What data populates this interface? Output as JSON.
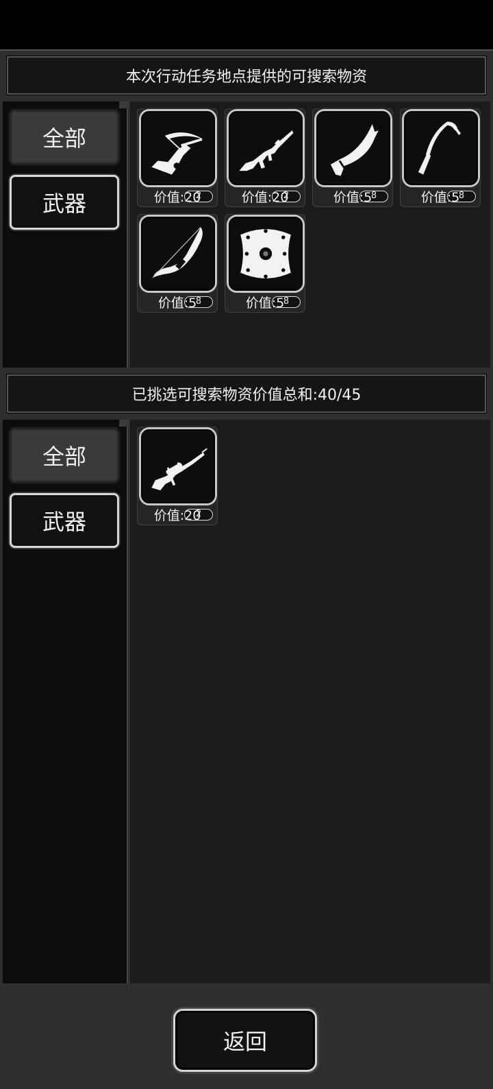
{
  "available": {
    "title": "本次行动任务地点提供的可搜索物资",
    "tabs": {
      "all": "全部",
      "weapon": "武器"
    },
    "items": [
      {
        "icon": "crossbow-icon",
        "count": "2",
        "value": "价值:20"
      },
      {
        "icon": "assault-rifle-icon",
        "count": "2",
        "value": "价值:20"
      },
      {
        "icon": "kukri-knife-icon",
        "count": "8",
        "value": "价值:5"
      },
      {
        "icon": "sickle-icon",
        "count": "8",
        "value": "价值:5"
      },
      {
        "icon": "recurve-bow-icon",
        "count": "8",
        "value": "价值:5"
      },
      {
        "icon": "round-shield-icon",
        "count": "8",
        "value": "价值:5"
      }
    ]
  },
  "selected": {
    "title": "已挑选可搜索物资价值总和:40/45",
    "tabs": {
      "all": "全部",
      "weapon": "武器"
    },
    "items": [
      {
        "icon": "sniper-rifle-icon",
        "count": "2",
        "value": "价值:20"
      }
    ]
  },
  "footer": {
    "back_label": "返回"
  }
}
